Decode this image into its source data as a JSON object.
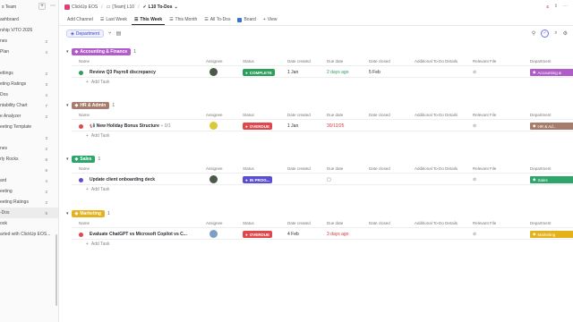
{
  "sidebar": {
    "title": "s Team",
    "items": [
      {
        "label": "ashboard",
        "count": ""
      },
      {
        "label": "rship V/TO 2026",
        "count": ""
      },
      {
        "label": "nes",
        "count": "2"
      },
      {
        "label": "Plan",
        "count": "4"
      },
      {
        "label": "",
        "count": ""
      },
      {
        "label": "ettings",
        "count": "2"
      },
      {
        "label": "eting Ratings",
        "count": "3"
      },
      {
        "label": "Dos",
        "count": "4"
      },
      {
        "label": "ntability Chart",
        "count": "7"
      },
      {
        "label": "e Analyzer",
        "count": "2"
      },
      {
        "label": "eeting Template",
        "count": ""
      },
      {
        "label": "",
        "count": "3"
      },
      {
        "label": "nes",
        "count": "2"
      },
      {
        "label": "rly Rocks",
        "count": "8"
      },
      {
        "label": "",
        "count": "6"
      },
      {
        "label": "ard",
        "count": "4"
      },
      {
        "label": "eeting",
        "count": "2"
      },
      {
        "label": "eeting Ratings",
        "count": "2"
      },
      {
        "label": "-Dos",
        "count": "5"
      },
      {
        "label": "ook",
        "count": ""
      },
      {
        "label": "arted with ClickUp EOS...",
        "count": ""
      }
    ]
  },
  "breadcrumb": [
    "ClickUp EOS",
    "[Team] L10",
    "L10 To-Dos"
  ],
  "header_right": {
    "badge": "4"
  },
  "tabs": [
    "Add Channel",
    "Last Week",
    "This Week",
    "This Month",
    "All To-Dos",
    "Board",
    "View"
  ],
  "toolbar": {
    "group_label": "Department"
  },
  "columns": [
    "Name",
    "Assignee",
    "Status",
    "Date created",
    "Due date",
    "Date closed",
    "Additional To-Do Details",
    "Relevant File",
    "Department"
  ],
  "add_task_label": "Add Task",
  "groups": [
    {
      "label": "Accounting & Finance",
      "count": "1",
      "color": "#b05cc9",
      "task": {
        "name": "Review Q3 Payroll discrepancy",
        "status": "COMPLETE",
        "status_color": "#2e9e5b",
        "date_created": "1 Jan",
        "due": "2 days ago",
        "due_color": "#2e9e5b",
        "closed": "5 Feb",
        "dept": "Accounting &",
        "dept_color": "#b05cc9"
      }
    },
    {
      "label": "HR & Admin",
      "count": "1",
      "color": "#a67c6d",
      "task": {
        "name": "New Holiday Bonus Structure",
        "subtasks": "0/1",
        "status": "OVERDUE",
        "status_color": "#e0474c",
        "date_created": "1 Jan",
        "due": "30/12/25",
        "due_color": "#d9363e",
        "closed": "",
        "dept": "HR & Ad...",
        "dept_color": "#a67c6d"
      }
    },
    {
      "label": "Sales",
      "count": "1",
      "color": "#2ea66b",
      "task": {
        "name": "Update client onboarding deck",
        "status": "IN PROG...",
        "status_color": "#5a4fd4",
        "date_created": "",
        "due": "",
        "due_color": "#555",
        "closed": "",
        "dept": "Sales",
        "dept_color": "#2ea66b"
      }
    },
    {
      "label": "Marketing",
      "count": "1",
      "color": "#e5b21b",
      "task": {
        "name": "Evaluate ChatGPT vs Microsoft Copilot vs C...",
        "status": "OVERDUE",
        "status_color": "#e0474c",
        "date_created": "4 Feb",
        "due": "3 days ago",
        "due_color": "#d9363e",
        "closed": "",
        "dept": "Marketing",
        "dept_color": "#e5b21b"
      }
    }
  ]
}
